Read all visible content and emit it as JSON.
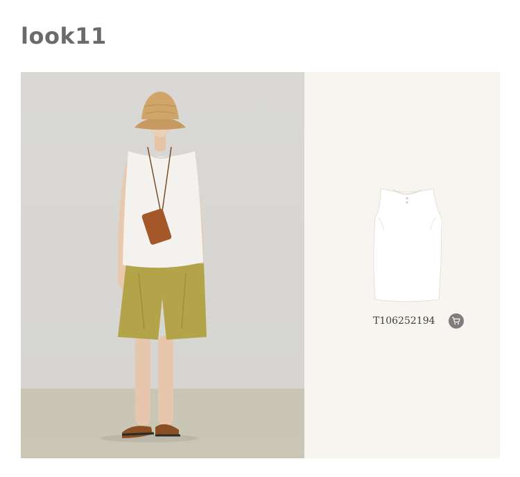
{
  "look": {
    "title": "look11"
  },
  "product": {
    "sku": "T106252194",
    "image": "white-sleeveless-top",
    "cart_icon": "shopping-cart-icon"
  },
  "photo": {
    "subject": "model-photo"
  },
  "colors": {
    "title": "#6b6b6b",
    "card_background": "#f8f5f0",
    "cart_button": "#7d7d7d"
  }
}
